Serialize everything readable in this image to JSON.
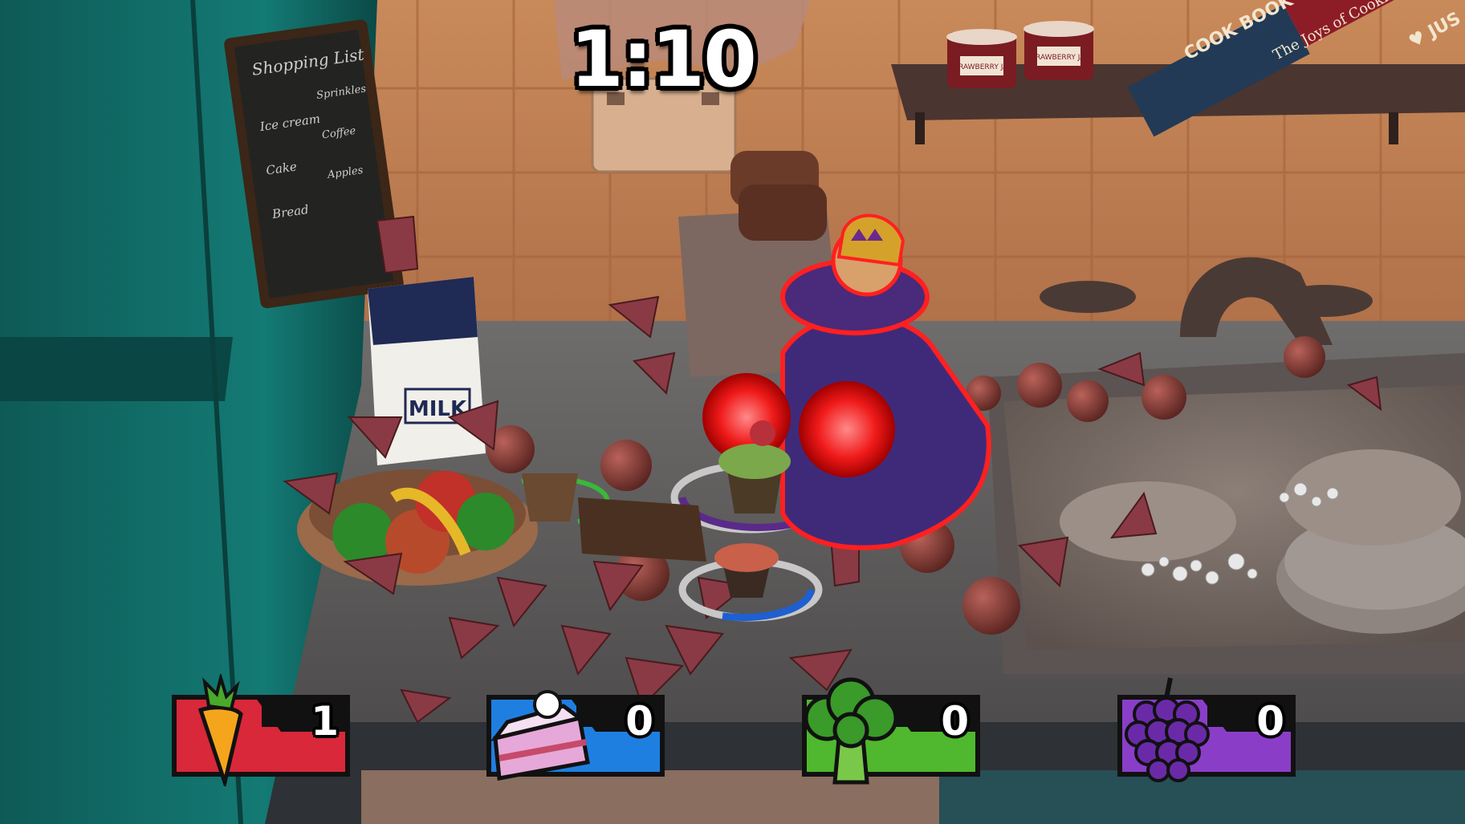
{
  "hud": {
    "timer": "1:10"
  },
  "players": [
    {
      "team": "carrot",
      "icon": "carrot-icon",
      "score": "1",
      "color": "#d8283a"
    },
    {
      "team": "cake",
      "icon": "cake-slice-icon",
      "score": "0",
      "color": "#1f7fe0"
    },
    {
      "team": "broccoli",
      "icon": "broccoli-icon",
      "score": "0",
      "color": "#4fb82e"
    },
    {
      "team": "grapes",
      "icon": "grapes-icon",
      "score": "0",
      "color": "#8a3ec8"
    }
  ],
  "scene": {
    "chalkboard": {
      "title": "Shopping List",
      "col1": [
        "Ice cream",
        "Cake",
        "Bread"
      ],
      "col2": [
        "Sprinkles",
        "Coffee",
        "Apples"
      ]
    },
    "milk_label": "MILK",
    "jar_labels": [
      "STRAWBERRY JAM",
      "STRAWBERRY JAM"
    ],
    "books": [
      "COOK BOOK",
      "The Joys of Cooking",
      "♥ JUS"
    ]
  }
}
